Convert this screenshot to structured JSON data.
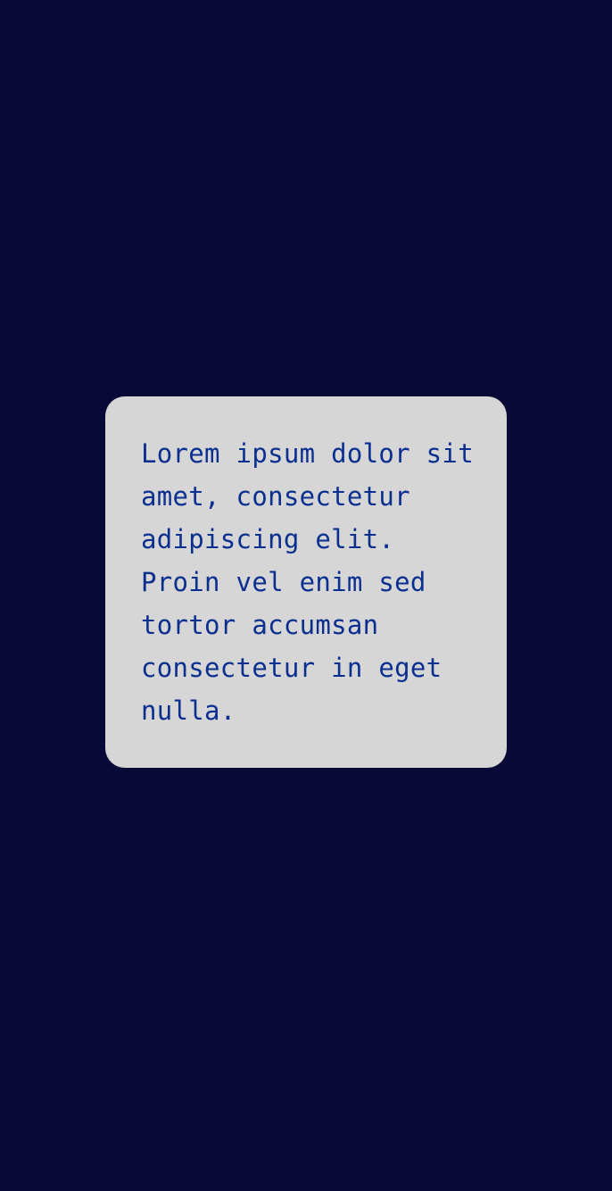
{
  "screen": {
    "background_color": "#080936"
  },
  "card": {
    "background_color": "#d6d6d6",
    "text_color": "#0b2f8f",
    "text": "Lorem ipsum dolor sit\namet, consectetur\nadipiscing elit.\nProin vel enim sed\ntortor accumsan\nconsectetur in eget\nnulla."
  }
}
